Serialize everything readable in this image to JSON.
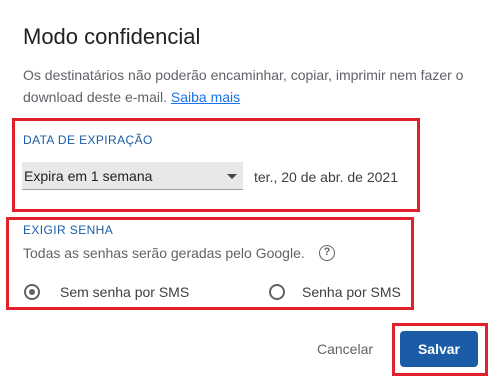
{
  "dialog": {
    "title": "Modo confidencial",
    "description": "Os destinatários não poderão encaminhar, copiar, imprimir nem fazer o download deste e-mail.",
    "learn_more": "Saiba mais"
  },
  "expiration": {
    "label": "DATA DE EXPIRAÇÃO",
    "selected_option": "Expira em 1 semana",
    "date_text": "ter., 20 de abr. de 2021"
  },
  "password": {
    "label": "EXIGIR SENHA",
    "info": "Todas as senhas serão geradas pelo Google.",
    "help_icon": "help-circle-icon",
    "options": [
      {
        "label": "Sem senha por SMS",
        "checked": true
      },
      {
        "label": "Senha por SMS",
        "checked": false
      }
    ]
  },
  "actions": {
    "cancel": "Cancelar",
    "save": "Salvar"
  },
  "colors": {
    "accent": "#1a5da6",
    "highlight_box": "#e0202a"
  }
}
